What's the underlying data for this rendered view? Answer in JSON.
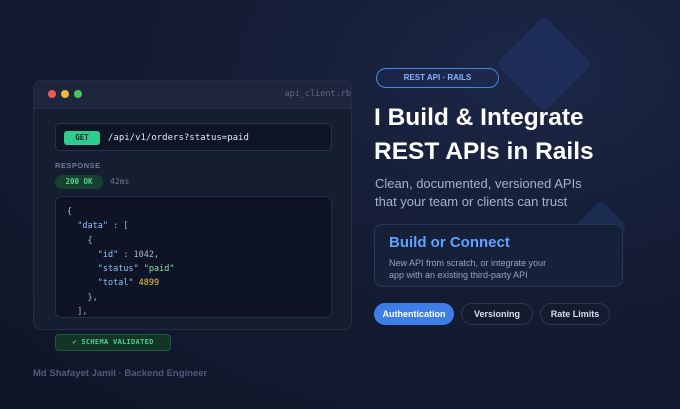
{
  "window": {
    "title": "api_client.rb"
  },
  "request": {
    "method": "GET",
    "endpoint": "/api/v1/orders?status=paid"
  },
  "response": {
    "label": "RESPONSE",
    "status": "200 OK",
    "latency": "42ms",
    "body_lines": [
      {
        "parts": [
          {
            "t": "{",
            "c": "p"
          }
        ]
      },
      {
        "parts": [
          {
            "t": "  ",
            "c": "p"
          },
          {
            "t": "\"data\"",
            "c": "k"
          },
          {
            "t": " : [",
            "c": "p"
          }
        ]
      },
      {
        "parts": [
          {
            "t": "    {",
            "c": "p"
          }
        ]
      },
      {
        "parts": [
          {
            "t": "      ",
            "c": "p"
          },
          {
            "t": "\"id\"",
            "c": "k"
          },
          {
            "t": " : 1042,",
            "c": "p"
          }
        ]
      },
      {
        "parts": [
          {
            "t": "      ",
            "c": "p"
          },
          {
            "t": "\"status\"",
            "c": "k"
          },
          {
            "t": " ",
            "c": "p"
          },
          {
            "t": "\"paid\"",
            "c": "s"
          }
        ]
      },
      {
        "parts": [
          {
            "t": "      ",
            "c": "p"
          },
          {
            "t": "\"total\"",
            "c": "k"
          },
          {
            "t": " ",
            "c": "p"
          },
          {
            "t": "4899",
            "c": "n"
          }
        ]
      },
      {
        "parts": [
          {
            "t": "    },",
            "c": "p"
          }
        ]
      },
      {
        "parts": [
          {
            "t": "  ],",
            "c": "p"
          }
        ]
      }
    ]
  },
  "validation": {
    "label": "✔ SCHEMA VALIDATED"
  },
  "author": "Md Shafayet Jamil · Backend Engineer",
  "hero": {
    "tag": "REST API · RAILS",
    "headline_line1": "I Build & Integrate",
    "headline_line2": "REST APIs in Rails",
    "subheadline_line1": "Clean, documented, versioned APIs",
    "subheadline_line2": "that your team or clients can trust"
  },
  "card": {
    "title": "Build or Connect",
    "body_line1": "New API from scratch, or integrate your",
    "body_line2": "app with an existing third-party API"
  },
  "chips": [
    "Authentication",
    "Versioning",
    "Rate Limits"
  ],
  "colors": {
    "accent": "#3d7ee6",
    "success": "#2ecc8f",
    "background": "#141c33"
  }
}
